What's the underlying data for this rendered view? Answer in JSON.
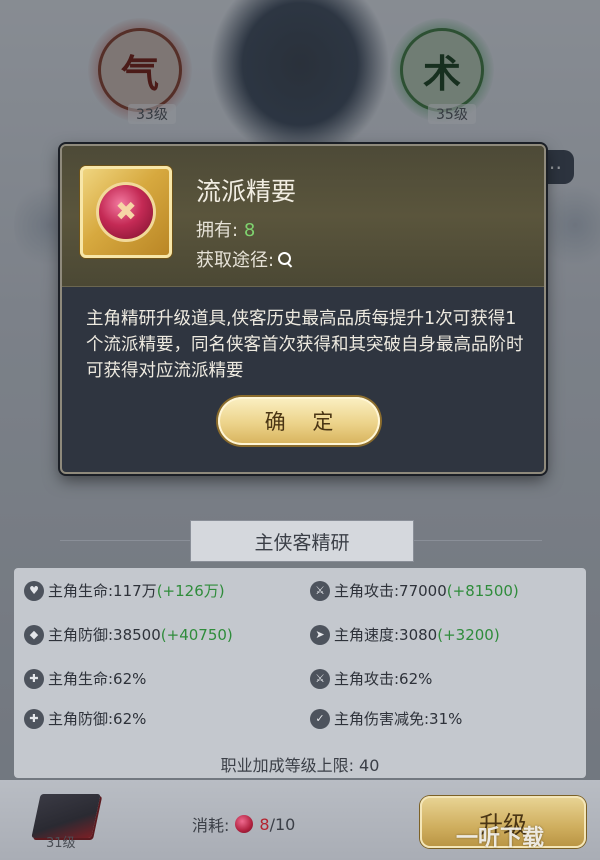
{
  "background": {
    "skill_left": {
      "glyph": "气",
      "level": "33级"
    },
    "skill_right": {
      "glyph": "术",
      "level": "35级"
    }
  },
  "popup": {
    "item_name": "流派精要",
    "owned_label": "拥有:",
    "owned_value": "8",
    "source_label": "获取途径:",
    "description": "主角精研升级道具,侠客历史最高品质每提升1次可获得1个流派精要，同名侠客首次获得和其突破自身最高品阶时可获得对应流派精要",
    "confirm_label": "确 定"
  },
  "panel": {
    "title": "主侠客精研",
    "stats": [
      {
        "label": "主角生命:117万",
        "bonus": "(+126万)"
      },
      {
        "label": "主角攻击:77000",
        "bonus": "(+81500)"
      },
      {
        "label": "主角防御:38500",
        "bonus": "(+40750)"
      },
      {
        "label": "主角速度:3080",
        "bonus": "(+3200)"
      },
      {
        "label": "主角生命:62%",
        "bonus": ""
      },
      {
        "label": "主角攻击:62%",
        "bonus": ""
      },
      {
        "label": "主角防御:62%",
        "bonus": ""
      },
      {
        "label": "主角伤害减免:31%",
        "bonus": ""
      }
    ],
    "limit_text": "职业加成等级上限: 40"
  },
  "bottom": {
    "book_level": "31级",
    "cost_label": "消耗:",
    "cost_have": "8",
    "cost_need": "/10",
    "upgrade_label": "升级"
  },
  "watermark": "一听下载",
  "colors": {
    "bonus_green": "#2f8c3b",
    "owned_green": "#7fd36f",
    "cost_red": "#b4232f",
    "button_gold": "#ecd38a"
  }
}
